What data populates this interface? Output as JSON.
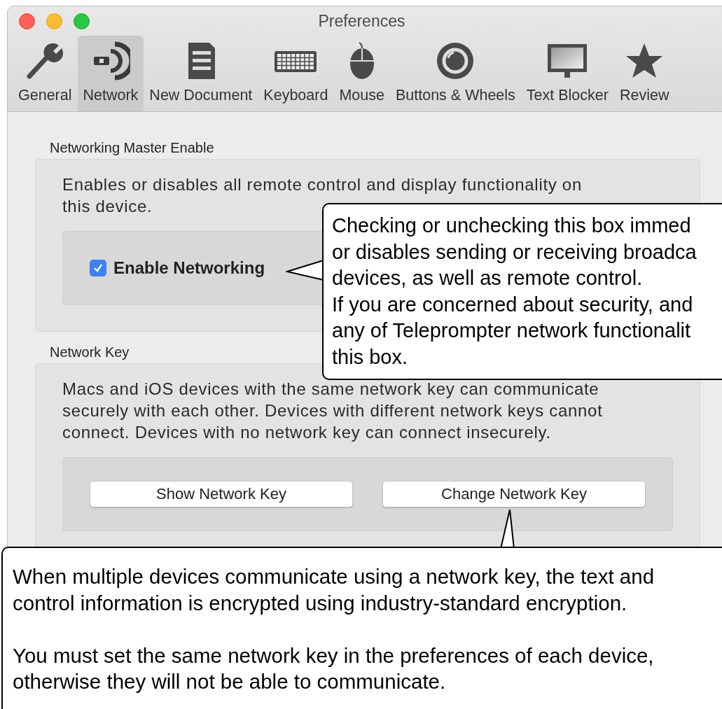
{
  "window": {
    "title": "Preferences"
  },
  "toolbar": [
    {
      "label": "General",
      "selected": false
    },
    {
      "label": "Network",
      "selected": true
    },
    {
      "label": "New Document",
      "selected": false
    },
    {
      "label": "Keyboard",
      "selected": false
    },
    {
      "label": "Mouse",
      "selected": false
    },
    {
      "label": "Buttons & Wheels",
      "selected": false
    },
    {
      "label": "Text Blocker",
      "selected": false
    },
    {
      "label": "Review",
      "selected": false
    }
  ],
  "sections": [
    {
      "title": "Networking Master Enable",
      "description": "Enables or disables all remote control and display functionality on this device.",
      "checkbox": {
        "label": "Enable Networking",
        "checked": true
      }
    },
    {
      "title": "Network Key",
      "description": "Macs and iOS devices with the same network key can communicate securely with each other. Devices with different network keys cannot connect. Devices with no network key can connect insecurely.",
      "buttons": [
        "Show Network Key",
        "Change Network Key"
      ]
    }
  ],
  "callouts": [
    {
      "lines": [
        "Checking or unchecking this box immed",
        "or disables sending or receiving broadca",
        "devices, as well as remote control.",
        "If you are concerned about security, and",
        "any of Teleprompter network functionalit",
        "this box."
      ]
    },
    {
      "paragraphs": [
        "When multiple devices communicate using a network key, the text and control information is encrypted using industry-standard encryption.",
        "You must set the same network key in the preferences of each device, otherwise they will not be able to communicate."
      ]
    }
  ]
}
